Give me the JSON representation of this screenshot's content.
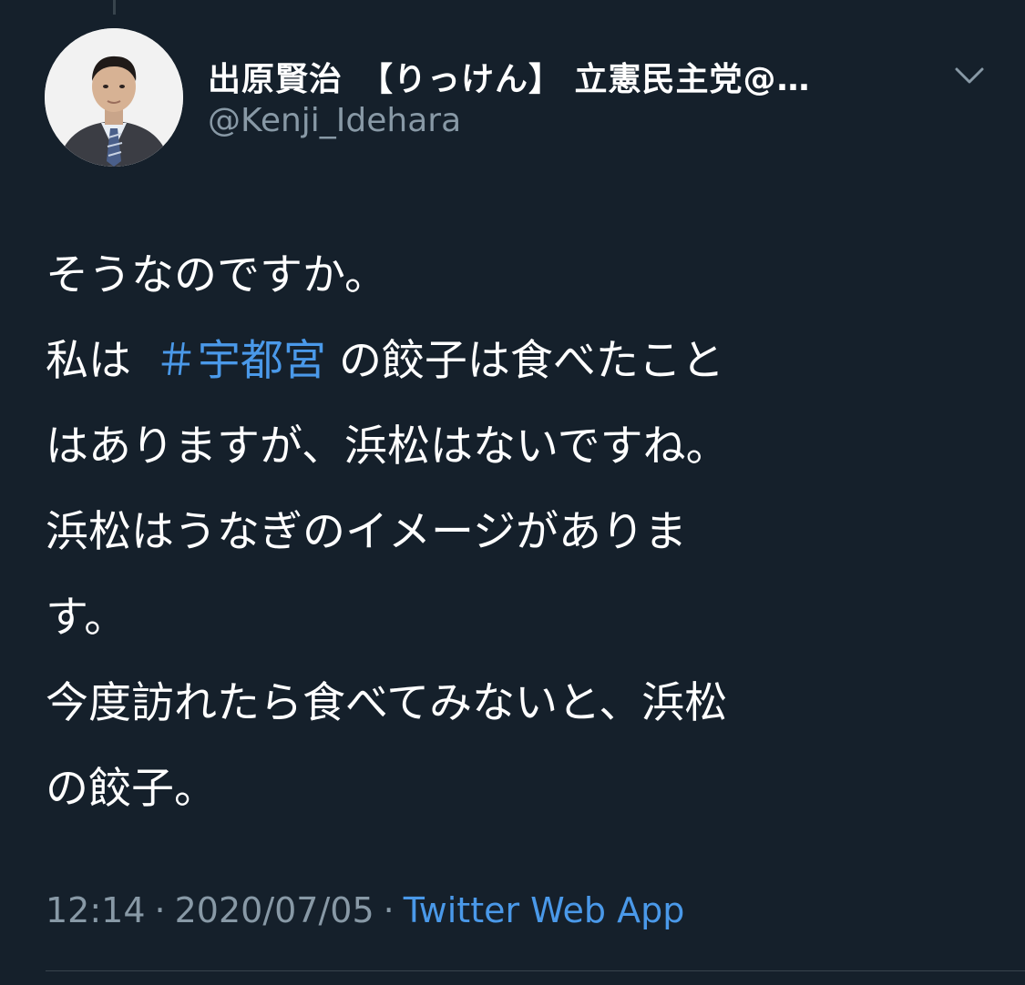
{
  "author": {
    "display_name": "出原賢治　【りっけん】 立憲民主党@…",
    "handle": "@Kenji_Idehara"
  },
  "tweet": {
    "line_1": "そうなのですか。",
    "line_2_prefix": "私は",
    "hashtag": "＃宇都宮",
    "line_2_suffix": "の餃子は食べたこと",
    "line_3": "はありますが、浜松はないですね。",
    "line_4": "浜松はうなぎのイメージがありま",
    "line_5": "す。",
    "line_6": "今度訪れたら食べてみないと、浜松",
    "line_7": "の餃子。"
  },
  "meta": {
    "time": "12:14",
    "separator": "·",
    "date": "2020/07/05",
    "source": "Twitter Web App"
  },
  "icons": {
    "menu": "chevron-down-icon",
    "avatar": "profile-photo"
  },
  "colors": {
    "background": "#15202b",
    "text": "#ffffff",
    "secondary_text": "#8899a6",
    "link": "#4a99e9",
    "divider": "#38444d"
  }
}
